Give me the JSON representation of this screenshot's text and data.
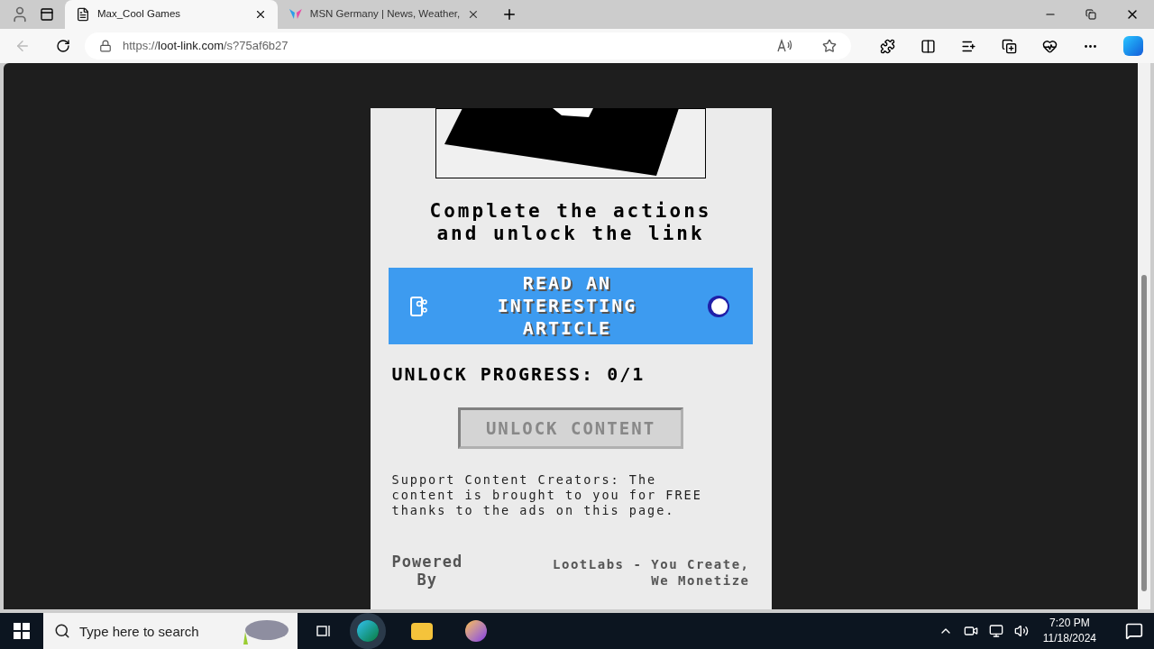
{
  "browser": {
    "tabs": [
      {
        "title": "Max_Cool Games",
        "selected": true,
        "kind": "page"
      },
      {
        "title": "MSN Germany | News, Weather,",
        "selected": false,
        "kind": "msn"
      }
    ],
    "address": {
      "scheme": "https://",
      "host": "loot-link.com",
      "path": "/s?75af6b27"
    }
  },
  "page": {
    "heading": [
      "Complete the actions",
      "and unlock the link"
    ],
    "task": {
      "label": [
        "READ AN",
        "INTERESTING",
        "ARTICLE"
      ],
      "loading": true
    },
    "progress": "UNLOCK PROGRESS: 0/1",
    "unlock_button": {
      "label": "UNLOCK CONTENT",
      "disabled": true
    },
    "support_text": [
      "Support Content Creators: The",
      "content is brought to you for FREE",
      "thanks to the ads on this page."
    ],
    "powered_by": {
      "label": [
        "Powered",
        "By"
      ],
      "tagline": [
        "LootLabs - You Create,",
        "We Monetize"
      ]
    }
  },
  "taskbar": {
    "search_placeholder": "Type here to search",
    "time": "7:20 PM",
    "date": "11/18/2024"
  }
}
